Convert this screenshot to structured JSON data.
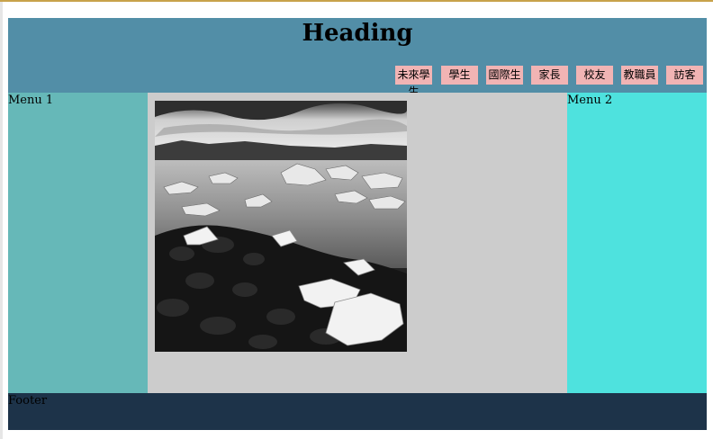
{
  "header": {
    "title": "Heading"
  },
  "nav": {
    "items": [
      {
        "label": "未來學生"
      },
      {
        "label": "學生"
      },
      {
        "label": "國際生"
      },
      {
        "label": "家長"
      },
      {
        "label": "校友"
      },
      {
        "label": "教職員"
      },
      {
        "label": "訪客"
      }
    ]
  },
  "menus": {
    "left": "Menu 1",
    "right": "Menu 2"
  },
  "footer": {
    "label": "Footer"
  },
  "colors": {
    "header_bg": "#528ea7",
    "nav_btn_bg": "#f1b4b4",
    "menu_left_bg": "#66b8b8",
    "main_bg": "#cccccc",
    "menu_right_bg": "#4ee2de",
    "footer_bg": "#1d3349"
  }
}
